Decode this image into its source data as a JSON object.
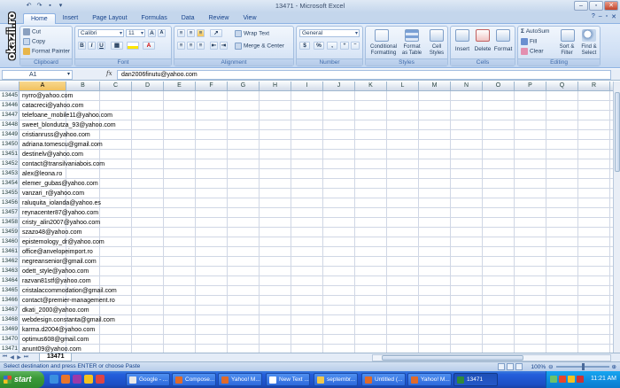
{
  "window": {
    "title": "13471 - Microsoft Excel"
  },
  "logo_text": "okazii.ro",
  "ribbon": {
    "tabs": [
      "Home",
      "Insert",
      "Page Layout",
      "Formulas",
      "Data",
      "Review",
      "View"
    ],
    "clipboard": {
      "cut": "Cut",
      "copy": "Copy",
      "format_painter": "Format Painter",
      "paste": "Paste",
      "label": "Clipboard"
    },
    "font": {
      "name": "Calibri",
      "size": "11",
      "label": "Font"
    },
    "alignment": {
      "wrap": "Wrap Text",
      "merge": "Merge & Center",
      "label": "Alignment"
    },
    "number": {
      "format": "General",
      "currency": "$",
      "percent": "%",
      "comma": ",",
      "label": "Number"
    },
    "styles": {
      "conditional": "Conditional\nFormatting",
      "format_table": "Format\nas Table",
      "cell_styles": "Cell\nStyles",
      "label": "Styles"
    },
    "cells": {
      "insert": "Insert",
      "delete": "Delete",
      "format": "Format",
      "label": "Cells"
    },
    "editing": {
      "autosum": "AutoSum",
      "fill": "Fill",
      "clear": "Clear",
      "sort": "Sort &\nFilter",
      "find": "Find &\nSelect",
      "label": "Editing"
    }
  },
  "formula_bar": {
    "cell_ref": "A1",
    "fx": "fx",
    "content": "dan2006finutu@yahoo.com"
  },
  "columns": [
    "A",
    "B",
    "C",
    "D",
    "E",
    "F",
    "G",
    "H",
    "I",
    "J",
    "K",
    "L",
    "M",
    "N",
    "O",
    "P",
    "Q",
    "R",
    "S"
  ],
  "selected_column": "A",
  "rows": [
    {
      "n": "13445",
      "a": "nyrro@yahoo.com"
    },
    {
      "n": "13446",
      "a": "catacreci@yahoo.com"
    },
    {
      "n": "13447",
      "a": "telefoane_mobile11@yahoo.com"
    },
    {
      "n": "13448",
      "a": "sweet_blondutza_93@yahoo.com"
    },
    {
      "n": "13449",
      "a": "cristianruss@yahoo.com"
    },
    {
      "n": "13450",
      "a": "adriana.tomescu@gmail.com"
    },
    {
      "n": "13451",
      "a": "destinelv@yahoo.com"
    },
    {
      "n": "13452",
      "a": "contact@transilvaniabois.com"
    },
    {
      "n": "13453",
      "a": "alex@leona.ro"
    },
    {
      "n": "13454",
      "a": "elemer_gubas@yahoo.com"
    },
    {
      "n": "13455",
      "a": "vanzari_r@yahoo.com"
    },
    {
      "n": "13456",
      "a": "raluquita_iolanda@yahoo.es"
    },
    {
      "n": "13457",
      "a": "reynacenter87@yahoo.com"
    },
    {
      "n": "13458",
      "a": "cristy_alin2007@yahoo.com"
    },
    {
      "n": "13459",
      "a": "szazo48@yahoo.com"
    },
    {
      "n": "13460",
      "a": "epistemology_dr@yahoo.com"
    },
    {
      "n": "13461",
      "a": "office@anvelopeimport.ro"
    },
    {
      "n": "13462",
      "a": "negreansenior@gmail.com"
    },
    {
      "n": "13463",
      "a": "odett_style@yahoo.com"
    },
    {
      "n": "13464",
      "a": "razvan81stf@yahoo.com"
    },
    {
      "n": "13465",
      "a": "cristalaccommodation@gmail.com"
    },
    {
      "n": "13466",
      "a": "contact@premier-management.ro"
    },
    {
      "n": "13467",
      "a": "dkati_2000@yahoo.com"
    },
    {
      "n": "13468",
      "a": "webdesign.constanta@gmail.com"
    },
    {
      "n": "13469",
      "a": "karma.d2004@yahoo.com"
    },
    {
      "n": "13470",
      "a": "optimus608@gmail.com"
    },
    {
      "n": "13471",
      "a": "anunt09@yahoo.com"
    }
  ],
  "sheet_tab": "13471",
  "status": {
    "text": "Select destination and press ENTER or choose Paste",
    "zoom": "100%"
  },
  "taskbar": {
    "start": "start",
    "tasks": [
      {
        "label": "Google - ...",
        "color": "#e9e9e9"
      },
      {
        "label": "Compose...",
        "color": "#e06a2a"
      },
      {
        "label": "Yahoo! M...",
        "color": "#e06a2a"
      },
      {
        "label": "New Text ...",
        "color": "#ffffff"
      },
      {
        "label": "septembr...",
        "color": "#f1c84b"
      },
      {
        "label": "Untitled (...",
        "color": "#e06a2a"
      },
      {
        "label": "Yahoo! M...",
        "color": "#e06a2a"
      },
      {
        "label": "13471",
        "color": "#2f8a3a"
      }
    ],
    "clock": "11:21 AM"
  }
}
